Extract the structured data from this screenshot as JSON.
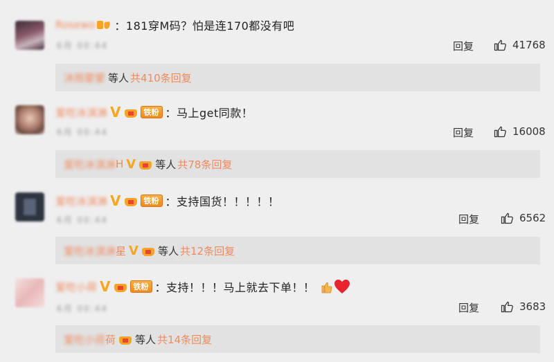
{
  "comments": [
    {
      "username": "Rosewo",
      "text": "：181穿M码？怕是连170都没有吧",
      "meta": "6月 00:44",
      "reply_label": "回复",
      "likes": "41768",
      "reply_names": "沐雨蒙蒙",
      "reply_tail": "",
      "reply_etc": "等人",
      "reply_count": "共410条回复",
      "badges": [
        "emoji"
      ]
    },
    {
      "username": "爱吃冰淇淋",
      "text": "：马上get同款！",
      "meta": "6月 00:44",
      "reply_label": "回复",
      "likes": "16008",
      "reply_names": "爱吃冰淇淋",
      "reply_tail": "H",
      "reply_etc": "等人",
      "reply_count": "共78条回复",
      "badges": [
        "v",
        "crown",
        "fan"
      ],
      "fan_label": "铁粉"
    },
    {
      "username": "爱吃冰淇淋",
      "text": "：支持国货！！！！！",
      "meta": "6月 00:44",
      "reply_label": "回复",
      "likes": "6562",
      "reply_names": "爱吃冰淇淋",
      "reply_tail": "星",
      "reply_etc": "等人",
      "reply_count": "共12条回复",
      "badges": [
        "v",
        "crown",
        "fan"
      ],
      "fan_label": "铁粉"
    },
    {
      "username": "爱吃小荷",
      "text": "：支持！！！马上就去下单！！",
      "meta": "6月 00:44",
      "reply_label": "回复",
      "likes": "3683",
      "reply_names": "爱吃小荷",
      "reply_tail": "荷",
      "reply_etc": "等人",
      "reply_count": "共14条回复",
      "badges": [
        "v",
        "crown",
        "fan"
      ],
      "fan_label": "铁粉",
      "trailing_emoji": [
        "thumbs-up",
        "heart"
      ]
    }
  ],
  "colors": {
    "background": "#efeff0",
    "reply_bar": "#e2e2e3",
    "accent_orange": "#f08a5d",
    "badge_gold": "#f5a623",
    "heart_red": "#e8252c"
  }
}
